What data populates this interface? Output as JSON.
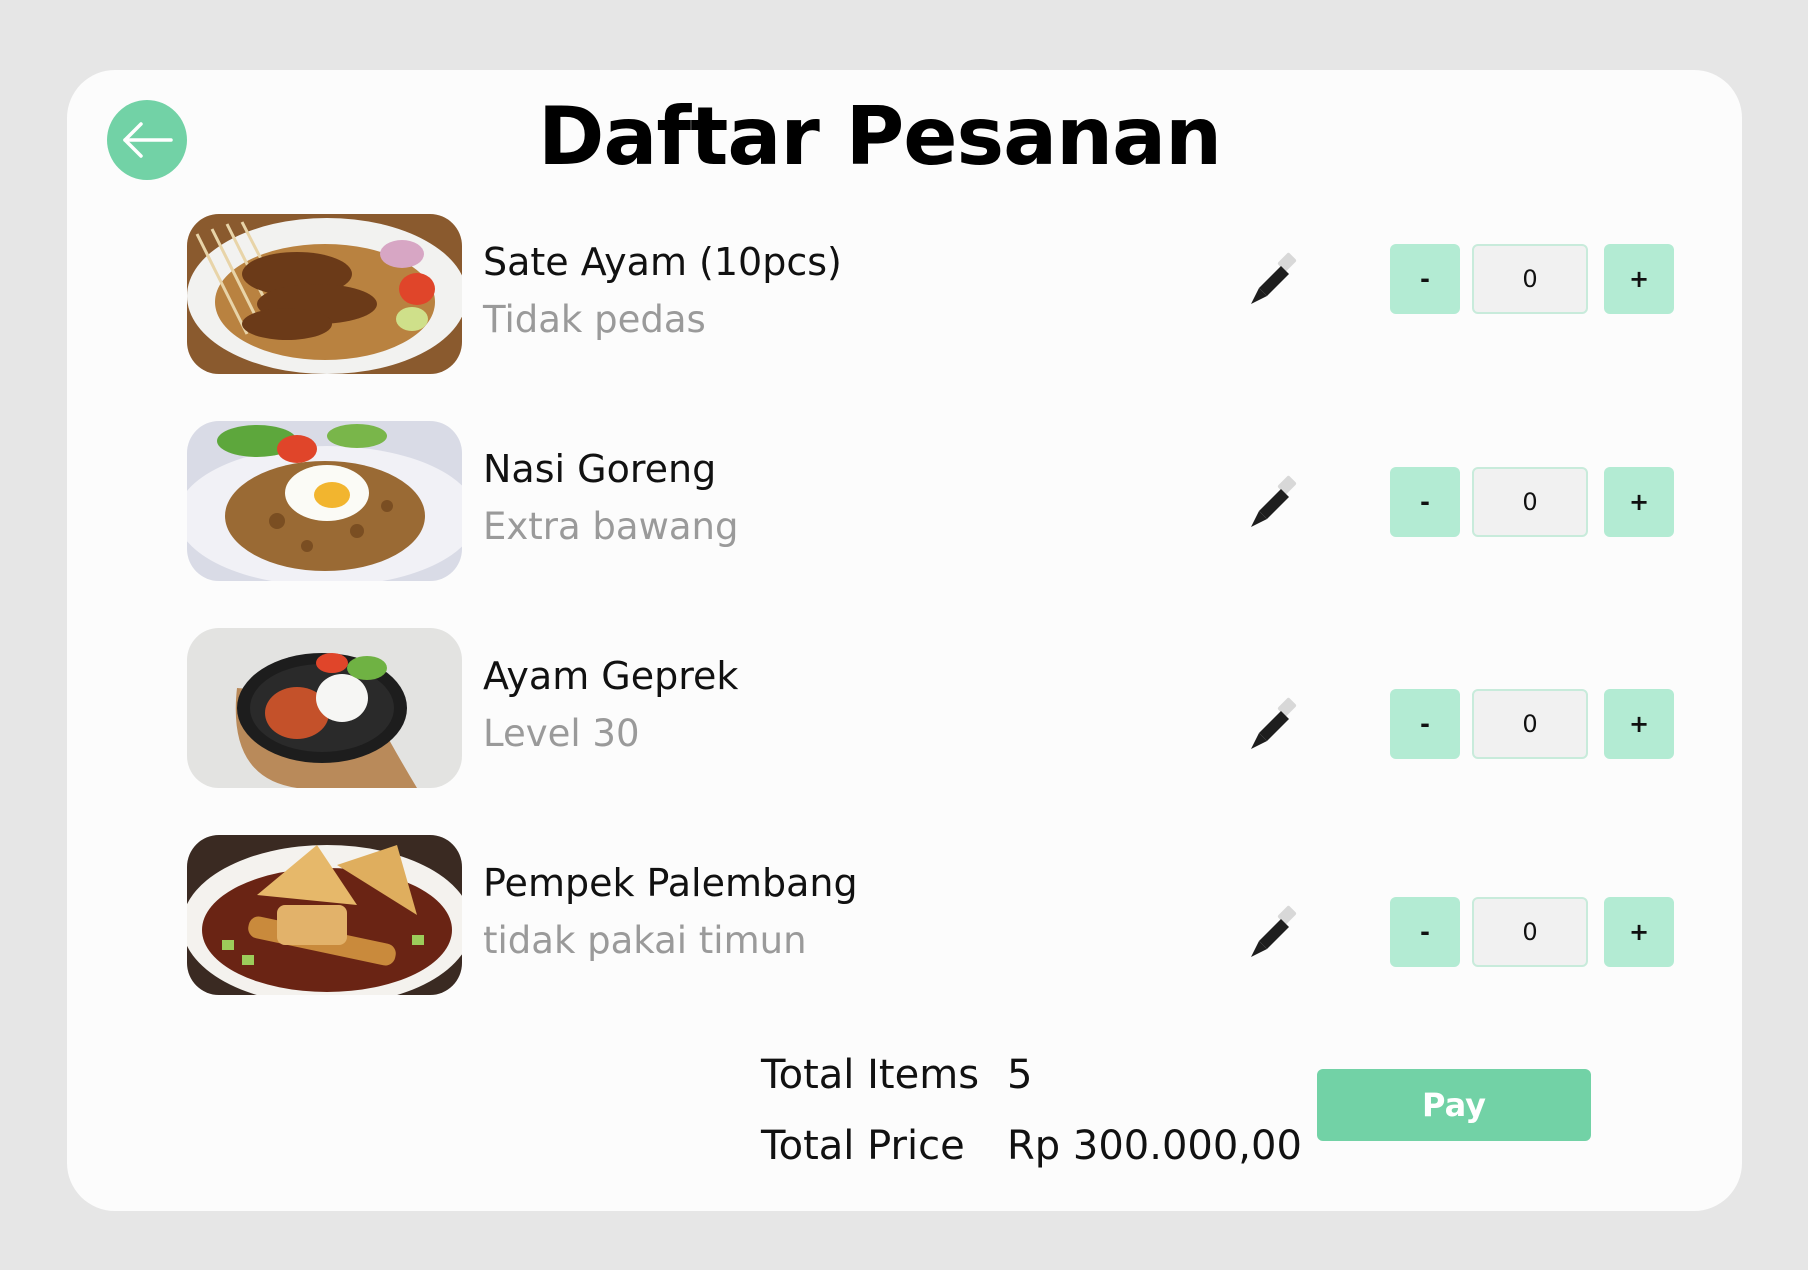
{
  "header": {
    "title": "Daftar Pesanan",
    "back_icon": "arrow-left-icon"
  },
  "items": [
    {
      "name": "Sate Ayam (10pcs)",
      "note": "Tidak pedas",
      "quantity": "0",
      "minus": "-",
      "plus": "+"
    },
    {
      "name": "Nasi Goreng",
      "note": "Extra bawang",
      "quantity": "0",
      "minus": "-",
      "plus": "+"
    },
    {
      "name": "Ayam Geprek",
      "note": "Level 30",
      "quantity": "0",
      "minus": "-",
      "plus": "+"
    },
    {
      "name": "Pempek Palembang",
      "note": "tidak pakai timun",
      "quantity": "0",
      "minus": "-",
      "plus": "+"
    }
  ],
  "summary": {
    "total_items_label": "Total Items",
    "total_items_value": "5",
    "total_price_label": "Total Price",
    "total_price_value": "Rp 300.000,00"
  },
  "pay_label": "Pay",
  "colors": {
    "accent": "#72d2a6",
    "accent_light": "#b3ebd3",
    "background": "#e6e6e6",
    "card": "#fcfcfc",
    "muted_text": "#9a9a9a"
  }
}
